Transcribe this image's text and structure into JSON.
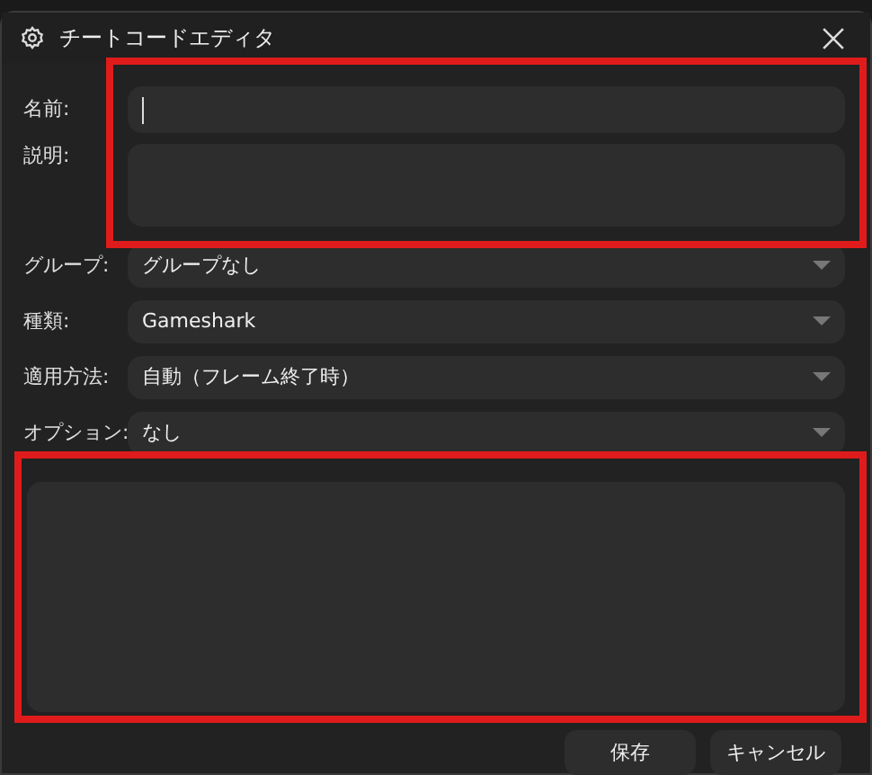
{
  "window": {
    "title": "チートコードエディタ"
  },
  "fields": [
    {
      "kind": "text",
      "label": "名前:",
      "focused": true
    },
    {
      "kind": "textarea",
      "label": "説明:"
    },
    {
      "kind": "select",
      "label": "グループ:",
      "value": "グループなし"
    },
    {
      "kind": "select",
      "label": "種類:",
      "value": "Gameshark"
    },
    {
      "kind": "select",
      "label": "適用方法:",
      "value": "自動（フレーム終了時）"
    },
    {
      "kind": "select",
      "label": "オプション:",
      "value": "なし"
    }
  ],
  "buttons": [
    "保存",
    "キャンセル"
  ]
}
